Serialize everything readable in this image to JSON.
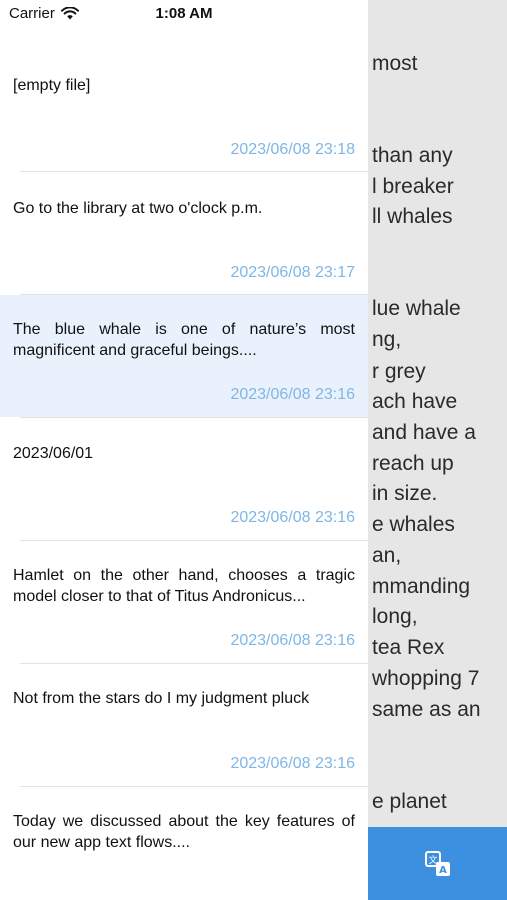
{
  "status_bar": {
    "carrier": "Carrier",
    "time": "1:08 AM"
  },
  "background_text": {
    "lines": [
      "most",
      "",
      "than any",
      "l breaker",
      "ll whales",
      "",
      "lue whale",
      "ng,",
      "r grey",
      "ach have",
      "and have a",
      "reach up",
      "in size.",
      "e whales",
      "an,",
      "mmanding",
      "long,",
      "tea Rex",
      "whopping 7",
      "same as an",
      "",
      "e planet"
    ]
  },
  "notes": [
    {
      "text": "[empty file]",
      "date": "2023/06/08 23:18",
      "selected": false
    },
    {
      "text": "Go to the library at two o'clock p.m.",
      "date": "2023/06/08 23:17",
      "selected": false
    },
    {
      "text": "The blue whale is one of nature’s most magnificent and graceful beings....",
      "date": "2023/06/08 23:16",
      "selected": true
    },
    {
      "text": "2023/06/01",
      "date": "2023/06/08 23:16",
      "selected": false
    },
    {
      "text": "Hamlet on the other hand, chooses a tragic model closer to that of Titus Andronicus...",
      "date": "2023/06/08 23:16",
      "selected": false
    },
    {
      "text": "Not from the stars do I my judgment pluck",
      "date": "2023/06/08 23:16",
      "selected": false
    },
    {
      "text": "Today we discussed about the key features of our new app text flows....",
      "date": "",
      "selected": false
    }
  ],
  "fab": {
    "icon": "translate-icon"
  },
  "colors": {
    "accent": "#3d8fe0",
    "date": "#7fb6e6",
    "selected_row": "#e9f2fc"
  }
}
